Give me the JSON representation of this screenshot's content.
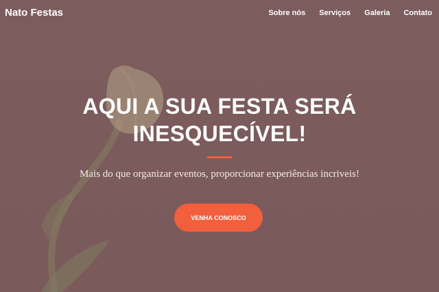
{
  "navbar": {
    "brand": "Nato Festas",
    "links": [
      "Sobre nós",
      "Serviços",
      "Galeria",
      "Contato"
    ]
  },
  "hero": {
    "headline_line1": "AQUI A SUA FESTA SERÁ",
    "headline_line2": "INESQUECÍVEL!",
    "tagline": "Mais do que organizar eventos, proporcionar experiências incriveis!",
    "cta_label": "VENHA CONOSCO",
    "background_image": "tulip-flower"
  },
  "colors": {
    "overlay": "#7b5b5c",
    "accent": "#f15f3d",
    "text": "#ffffff"
  }
}
